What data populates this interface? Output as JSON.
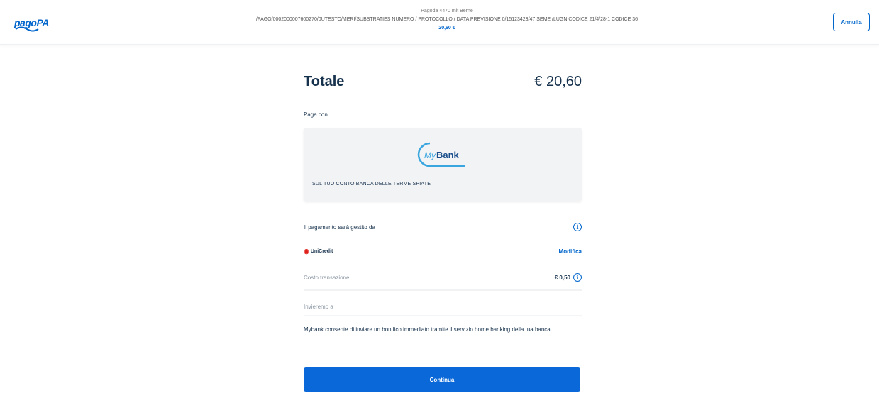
{
  "header": {
    "logo_text": "pagoPA",
    "line1": "Pagoda 4470 mit Berne",
    "line2": "/PAGO/0002000007600270/0UTESTO/MERI/SUBSTRATIES NUMERO / PROTOCOLLO / DATA PREVISIONE 0/15123423/47 SEME /LUGN CODICE 21/4/28-1 CODICE 36",
    "line3": "20,60 €",
    "cancel_label": "Annulla"
  },
  "summary": {
    "total_label": "Totale",
    "total_amount": "€ 20,60"
  },
  "payment_method": {
    "pay_with_label": "Paga con",
    "brand_name": "MyBank",
    "brand_prefix": "My",
    "brand_suffix": "Bank",
    "description": "SUL TUO CONTO BANCA DELLE TERME SPIATE"
  },
  "psp": {
    "managed_by_label": "Il pagamento sarà gestito da",
    "name": "UniCredit",
    "modify_label": "Modifica",
    "fee_label": "Costo transazione",
    "fee_amount": "€ 0,50"
  },
  "receipt": {
    "send_to_label": "Invieremo a"
  },
  "info_text": "Mybank consente di inviare un bonifico immediato tramite il servizio home banking della tua banca.",
  "actions": {
    "continue_label": "Continua"
  },
  "colors": {
    "primary": "#0066cc",
    "button": "#0a68d8",
    "card_bg": "#f2f3f5",
    "text": "#17324d"
  },
  "icons": [
    "info-icon",
    "unicredit-logo-icon",
    "mybank-logo-icon"
  ]
}
